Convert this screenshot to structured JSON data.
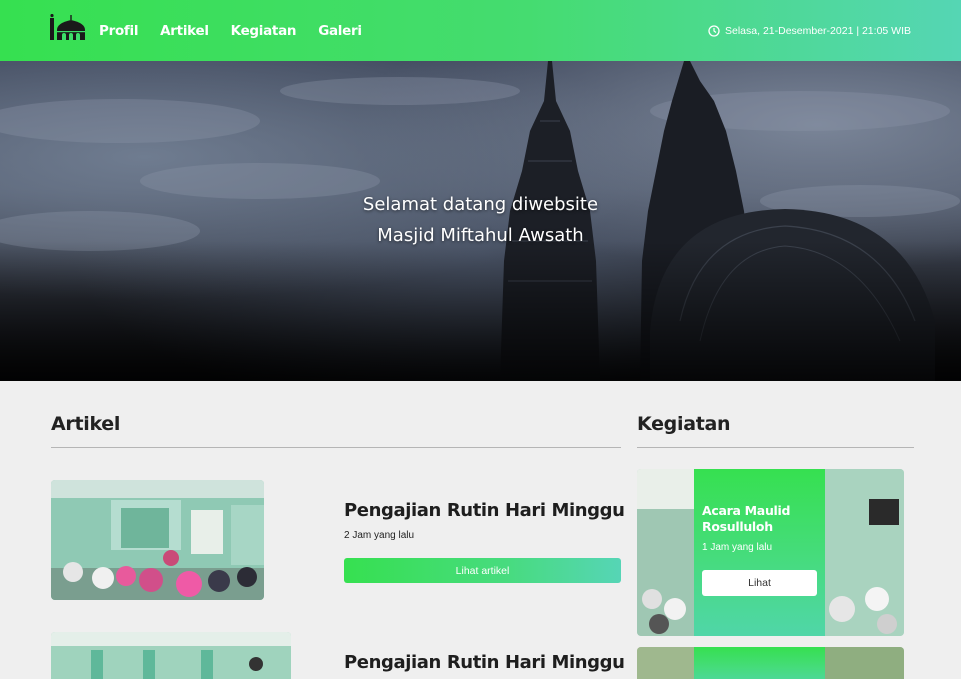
{
  "nav": {
    "brand_icon": "mosque-logo-icon",
    "links": [
      "Profil",
      "Artikel",
      "Kegiatan",
      "Galeri"
    ],
    "datetime": "Selasa, 21-Desember-2021 | 21:05 WIB",
    "clock_icon": "clock-icon"
  },
  "hero": {
    "line1": "Selamat datang diwebsite",
    "line2": "Masjid Miftahul Awsath"
  },
  "artikel": {
    "heading": "Artikel",
    "items": [
      {
        "title": "Pengajian Rutin Hari Minggu",
        "time": "2 Jam yang lalu",
        "button": "Lihat artikel"
      },
      {
        "title": "Pengajian Rutin Hari Minggu"
      }
    ]
  },
  "kegiatan": {
    "heading": "Kegiatan",
    "items": [
      {
        "title": "Acara Maulid Rosulluloh",
        "time": "1 Jam yang lalu",
        "button": "Lihat"
      }
    ]
  },
  "colors": {
    "gradient_start": "#36e050",
    "gradient_end": "#56d5b6",
    "page_background": "#efefef"
  }
}
